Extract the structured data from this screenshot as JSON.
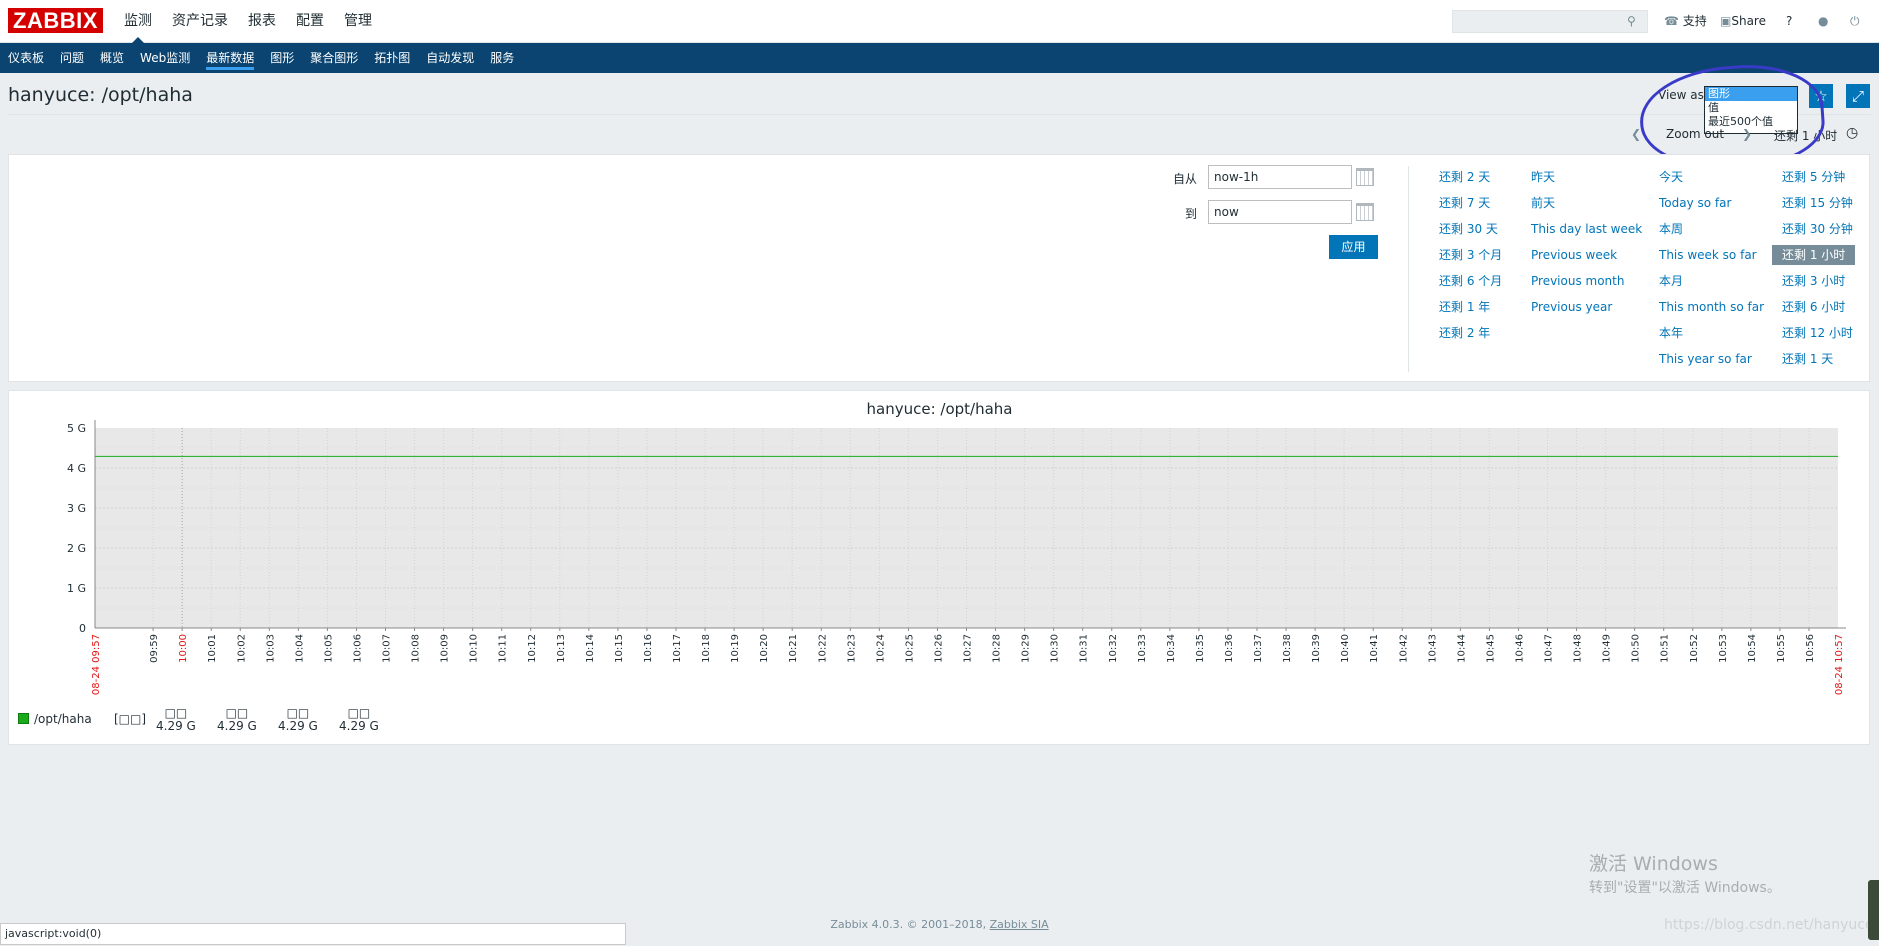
{
  "header": {
    "logo": "ZABBIX",
    "nav": [
      "监测",
      "资产记录",
      "报表",
      "配置",
      "管理"
    ],
    "nav_active_index": 0,
    "search_placeholder": "",
    "support": "支持",
    "share": "Share",
    "help": "?"
  },
  "subnav": {
    "items": [
      "仪表板",
      "问题",
      "概览",
      "Web监测",
      "最新数据",
      "图形",
      "聚合图形",
      "拓扑图",
      "自动发现",
      "服务"
    ],
    "active_index": 4
  },
  "page": {
    "title": "hanyuce: /opt/haha",
    "view_as_label": "View as",
    "view_as_options": [
      "图形",
      "值",
      "最近500个值"
    ],
    "view_as_selected": "图形",
    "zoom_out": "Zoom out",
    "period_label": "还剩 1 小时"
  },
  "filter": {
    "from_label": "自从",
    "from_value": "now-1h",
    "to_label": "到",
    "to_value": "now",
    "apply": "应用",
    "quick": [
      [
        "还剩 2 天",
        "还剩 7 天",
        "还剩 30 天",
        "还剩 3 个月",
        "还剩 6 个月",
        "还剩 1 年",
        "还剩 2 年"
      ],
      [
        "昨天",
        "前天",
        "This day last week",
        "Previous week",
        "Previous month",
        "Previous year"
      ],
      [
        "今天",
        "Today so far",
        "本周",
        "This week so far",
        "本月",
        "This month so far",
        "本年",
        "This year so far"
      ],
      [
        "还剩 5 分钟",
        "还剩 15 分钟",
        "还剩 30 分钟",
        "还剩 1 小时",
        "还剩 3 小时",
        "还剩 6 小时",
        "还剩 12 小时",
        "还剩 1 天"
      ]
    ],
    "selected": "还剩 1 小时"
  },
  "graph": {
    "title": "hanyuce: /opt/haha",
    "legend_name": "/opt/haha",
    "legend_func": "[□□]",
    "stat_headers": [
      "□□",
      "□□",
      "□□",
      "□□"
    ],
    "stat_values": [
      "4.29 G",
      "4.29 G",
      "4.29 G",
      "4.29 G"
    ],
    "line_color": "#1aab1a"
  },
  "chart_data": {
    "type": "line",
    "title": "hanyuce: /opt/haha",
    "y_ticks": [
      "0",
      "1 G",
      "2 G",
      "3 G",
      "4 G",
      "5 G"
    ],
    "ylim": [
      0,
      5
    ],
    "x_start_label": "08-24 09:57",
    "x_end_label": "08-24 10:57",
    "x_labels": [
      "09:59",
      "10:00",
      "10:01",
      "10:02",
      "10:03",
      "10:04",
      "10:05",
      "10:06",
      "10:07",
      "10:08",
      "10:09",
      "10:10",
      "10:11",
      "10:12",
      "10:13",
      "10:14",
      "10:15",
      "10:16",
      "10:17",
      "10:18",
      "10:19",
      "10:20",
      "10:21",
      "10:22",
      "10:23",
      "10:24",
      "10:25",
      "10:26",
      "10:27",
      "10:28",
      "10:29",
      "10:30",
      "10:31",
      "10:32",
      "10:33",
      "10:34",
      "10:35",
      "10:36",
      "10:37",
      "10:38",
      "10:39",
      "10:40",
      "10:41",
      "10:42",
      "10:43",
      "10:44",
      "10:45",
      "10:46",
      "10:47",
      "10:48",
      "10:49",
      "10:50",
      "10:51",
      "10:52",
      "10:53",
      "10:54",
      "10:55",
      "10:56",
      "10:57"
    ],
    "highlight_labels": [
      "10:00"
    ],
    "series": [
      {
        "name": "/opt/haha",
        "values": [
          4.29,
          4.29
        ]
      }
    ],
    "grid": true
  },
  "footer": {
    "text": "Zabbix 4.0.3. © 2001–2018, ",
    "link": "Zabbix SIA",
    "status": "javascript:void(0)",
    "watermark_title": "激活 Windows",
    "watermark_sub": "转到\"设置\"以激活 Windows。",
    "watermark_url": "https://blog.csdn.net/hanyuce"
  }
}
